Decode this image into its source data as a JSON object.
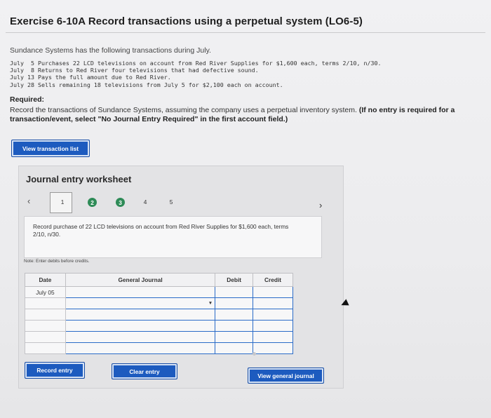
{
  "title": "Exercise 6-10A Record transactions using a perpetual system (LO6-5)",
  "intro": "Sundance Systems has the following transactions during July.",
  "transactions": [
    "July  5 Purchases 22 LCD televisions on account from Red River Supplies for $1,600 each, terms 2/10, n/30.",
    "July  8 Returns to Red River four televisions that had defective sound.",
    "July 13 Pays the full amount due to Red River.",
    "July 28 Sells remaining 18 televisions from July 5 for $2,100 each on account."
  ],
  "required": {
    "heading": "Required:",
    "text": "Record the transactions of Sundance Systems, assuming the company uses a perpetual inventory system.",
    "bold_text": "(If no entry is required for a transaction/event, select \"No Journal Entry Required\" in the first account field.)"
  },
  "buttons": {
    "view_transaction_list": "View transaction list",
    "record_entry": "Record entry",
    "clear_entry": "Clear entry",
    "view_general_journal": "View general journal"
  },
  "worksheet": {
    "title": "Journal entry worksheet",
    "steps": [
      "1",
      "2",
      "3",
      "4",
      "5"
    ],
    "completed_steps": [
      2,
      3
    ],
    "current_step": 1,
    "description": "Record purchase of 22 LCD televisions on account from Red River Supplies for $1,600 each, terms 2/10, n/30.",
    "note": "Note: Enter debits before credits.",
    "columns": {
      "date": "Date",
      "general_journal": "General Journal",
      "debit": "Debit",
      "credit": "Credit"
    },
    "date_value": "July 05"
  },
  "colors": {
    "button_blue": "#1d5bbf",
    "step_done": "#2e8b57",
    "entry_border": "#2a6bc8"
  },
  "icons": {
    "prev": "chevron-left-icon",
    "next": "chevron-right-icon",
    "dropdown": "caret-down-icon"
  }
}
